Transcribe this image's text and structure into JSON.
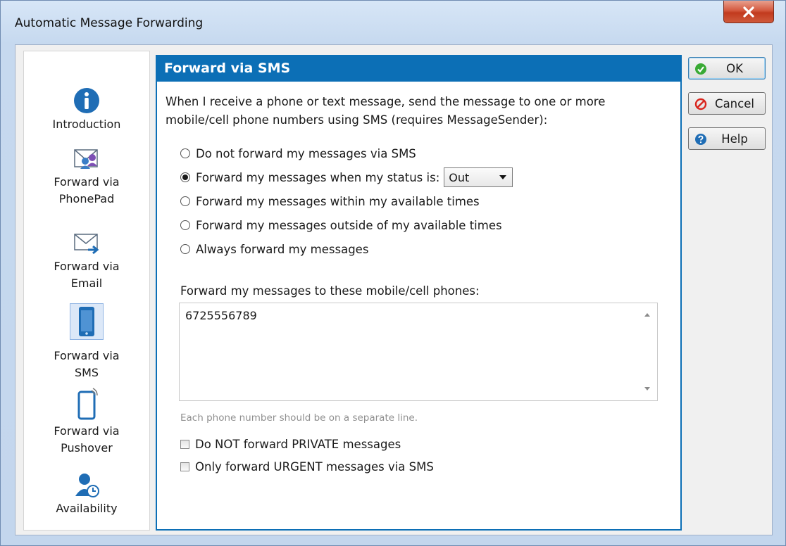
{
  "window": {
    "title": "Automatic Message Forwarding",
    "close_glyph": "✕"
  },
  "sidebar": {
    "items": [
      {
        "label": "Introduction",
        "icon": "info-icon"
      },
      {
        "label": "Forward via PhonePad",
        "line1": "Forward via",
        "line2": "PhonePad",
        "icon": "phonepad-icon"
      },
      {
        "label": "Forward via Email",
        "line1": "Forward via",
        "line2": "Email",
        "icon": "email-icon"
      },
      {
        "label": "Forward via SMS",
        "line1": "Forward via",
        "line2": "SMS",
        "icon": "mobile-phone-icon",
        "selected": true
      },
      {
        "label": "Forward via Pushover",
        "line1": "Forward via",
        "line2": "Pushover",
        "icon": "pushover-icon"
      },
      {
        "label": "Availability",
        "icon": "availability-icon"
      }
    ]
  },
  "panel": {
    "title": "Forward via SMS",
    "intro_line1": "When I receive a phone or text message, send the message to one or more",
    "intro_line2": "mobile/cell phone numbers using SMS (requires MessageSender):",
    "options": [
      {
        "label": "Do not forward my messages via SMS",
        "checked": false
      },
      {
        "label": "Forward my messages when my status is:",
        "checked": true
      },
      {
        "label": "Forward my messages within my available times",
        "checked": false
      },
      {
        "label": "Forward my messages outside of my available times",
        "checked": false
      },
      {
        "label": "Always forward my messages",
        "checked": false
      }
    ],
    "status_select": {
      "value": "Out"
    },
    "phones_label": "Forward my messages to these mobile/cell phones:",
    "phones_value": "6725556789",
    "hint": "Each phone number should be on a separate line.",
    "checkboxes": [
      {
        "label": "Do NOT forward PRIVATE messages",
        "checked": false
      },
      {
        "label": "Only forward URGENT messages via SMS",
        "checked": false
      }
    ]
  },
  "buttons": {
    "ok": "OK",
    "cancel": "Cancel",
    "help": "Help"
  },
  "colors": {
    "accent": "#0c6fb6",
    "ok_icon": "#3aaa35",
    "cancel_icon": "#d9251d",
    "help_icon": "#1f6db5"
  }
}
